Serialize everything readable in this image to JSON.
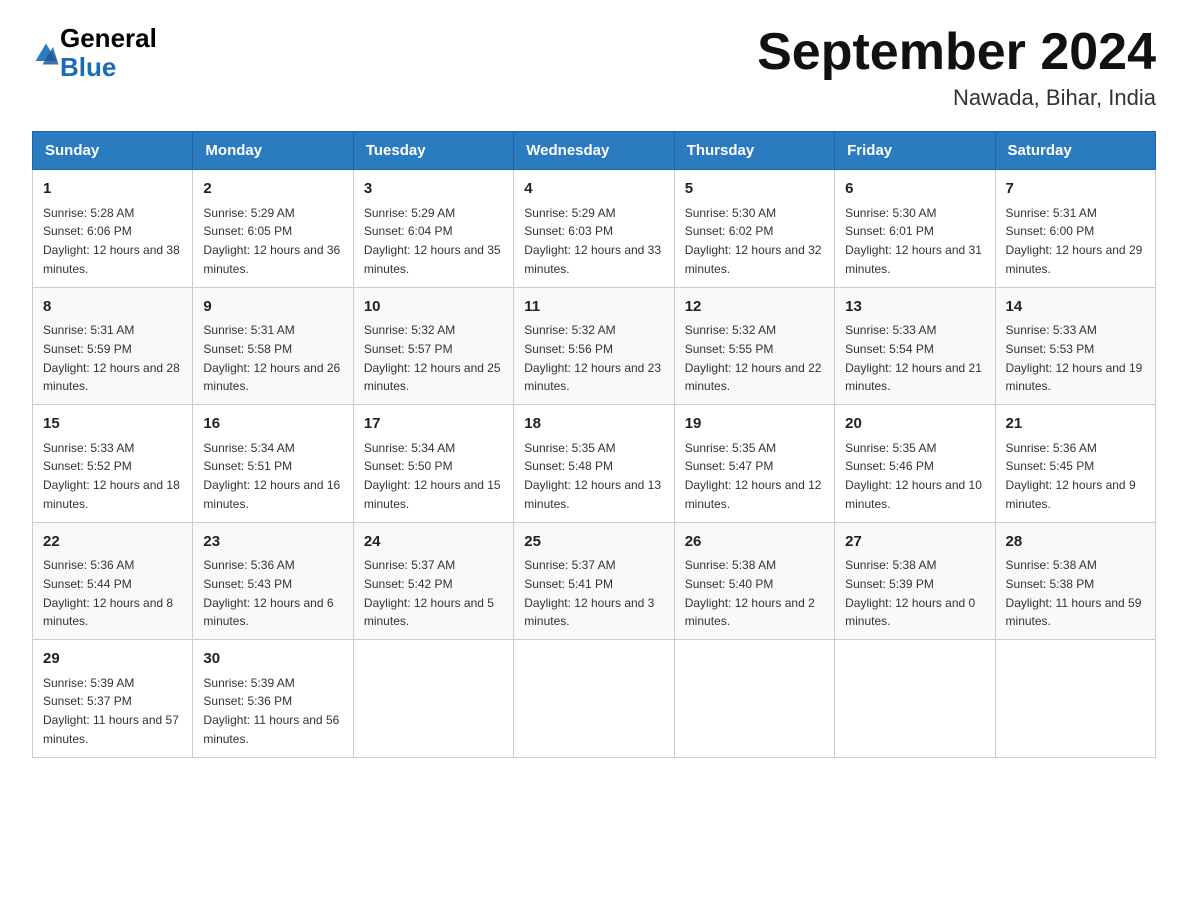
{
  "logo": {
    "general": "General",
    "blue": "Blue"
  },
  "title": "September 2024",
  "location": "Nawada, Bihar, India",
  "days_of_week": [
    "Sunday",
    "Monday",
    "Tuesday",
    "Wednesday",
    "Thursday",
    "Friday",
    "Saturday"
  ],
  "weeks": [
    [
      {
        "date": "1",
        "sunrise": "5:28 AM",
        "sunset": "6:06 PM",
        "daylight": "12 hours and 38 minutes."
      },
      {
        "date": "2",
        "sunrise": "5:29 AM",
        "sunset": "6:05 PM",
        "daylight": "12 hours and 36 minutes."
      },
      {
        "date": "3",
        "sunrise": "5:29 AM",
        "sunset": "6:04 PM",
        "daylight": "12 hours and 35 minutes."
      },
      {
        "date": "4",
        "sunrise": "5:29 AM",
        "sunset": "6:03 PM",
        "daylight": "12 hours and 33 minutes."
      },
      {
        "date": "5",
        "sunrise": "5:30 AM",
        "sunset": "6:02 PM",
        "daylight": "12 hours and 32 minutes."
      },
      {
        "date": "6",
        "sunrise": "5:30 AM",
        "sunset": "6:01 PM",
        "daylight": "12 hours and 31 minutes."
      },
      {
        "date": "7",
        "sunrise": "5:31 AM",
        "sunset": "6:00 PM",
        "daylight": "12 hours and 29 minutes."
      }
    ],
    [
      {
        "date": "8",
        "sunrise": "5:31 AM",
        "sunset": "5:59 PM",
        "daylight": "12 hours and 28 minutes."
      },
      {
        "date": "9",
        "sunrise": "5:31 AM",
        "sunset": "5:58 PM",
        "daylight": "12 hours and 26 minutes."
      },
      {
        "date": "10",
        "sunrise": "5:32 AM",
        "sunset": "5:57 PM",
        "daylight": "12 hours and 25 minutes."
      },
      {
        "date": "11",
        "sunrise": "5:32 AM",
        "sunset": "5:56 PM",
        "daylight": "12 hours and 23 minutes."
      },
      {
        "date": "12",
        "sunrise": "5:32 AM",
        "sunset": "5:55 PM",
        "daylight": "12 hours and 22 minutes."
      },
      {
        "date": "13",
        "sunrise": "5:33 AM",
        "sunset": "5:54 PM",
        "daylight": "12 hours and 21 minutes."
      },
      {
        "date": "14",
        "sunrise": "5:33 AM",
        "sunset": "5:53 PM",
        "daylight": "12 hours and 19 minutes."
      }
    ],
    [
      {
        "date": "15",
        "sunrise": "5:33 AM",
        "sunset": "5:52 PM",
        "daylight": "12 hours and 18 minutes."
      },
      {
        "date": "16",
        "sunrise": "5:34 AM",
        "sunset": "5:51 PM",
        "daylight": "12 hours and 16 minutes."
      },
      {
        "date": "17",
        "sunrise": "5:34 AM",
        "sunset": "5:50 PM",
        "daylight": "12 hours and 15 minutes."
      },
      {
        "date": "18",
        "sunrise": "5:35 AM",
        "sunset": "5:48 PM",
        "daylight": "12 hours and 13 minutes."
      },
      {
        "date": "19",
        "sunrise": "5:35 AM",
        "sunset": "5:47 PM",
        "daylight": "12 hours and 12 minutes."
      },
      {
        "date": "20",
        "sunrise": "5:35 AM",
        "sunset": "5:46 PM",
        "daylight": "12 hours and 10 minutes."
      },
      {
        "date": "21",
        "sunrise": "5:36 AM",
        "sunset": "5:45 PM",
        "daylight": "12 hours and 9 minutes."
      }
    ],
    [
      {
        "date": "22",
        "sunrise": "5:36 AM",
        "sunset": "5:44 PM",
        "daylight": "12 hours and 8 minutes."
      },
      {
        "date": "23",
        "sunrise": "5:36 AM",
        "sunset": "5:43 PM",
        "daylight": "12 hours and 6 minutes."
      },
      {
        "date": "24",
        "sunrise": "5:37 AM",
        "sunset": "5:42 PM",
        "daylight": "12 hours and 5 minutes."
      },
      {
        "date": "25",
        "sunrise": "5:37 AM",
        "sunset": "5:41 PM",
        "daylight": "12 hours and 3 minutes."
      },
      {
        "date": "26",
        "sunrise": "5:38 AM",
        "sunset": "5:40 PM",
        "daylight": "12 hours and 2 minutes."
      },
      {
        "date": "27",
        "sunrise": "5:38 AM",
        "sunset": "5:39 PM",
        "daylight": "12 hours and 0 minutes."
      },
      {
        "date": "28",
        "sunrise": "5:38 AM",
        "sunset": "5:38 PM",
        "daylight": "11 hours and 59 minutes."
      }
    ],
    [
      {
        "date": "29",
        "sunrise": "5:39 AM",
        "sunset": "5:37 PM",
        "daylight": "11 hours and 57 minutes."
      },
      {
        "date": "30",
        "sunrise": "5:39 AM",
        "sunset": "5:36 PM",
        "daylight": "11 hours and 56 minutes."
      },
      null,
      null,
      null,
      null,
      null
    ]
  ]
}
